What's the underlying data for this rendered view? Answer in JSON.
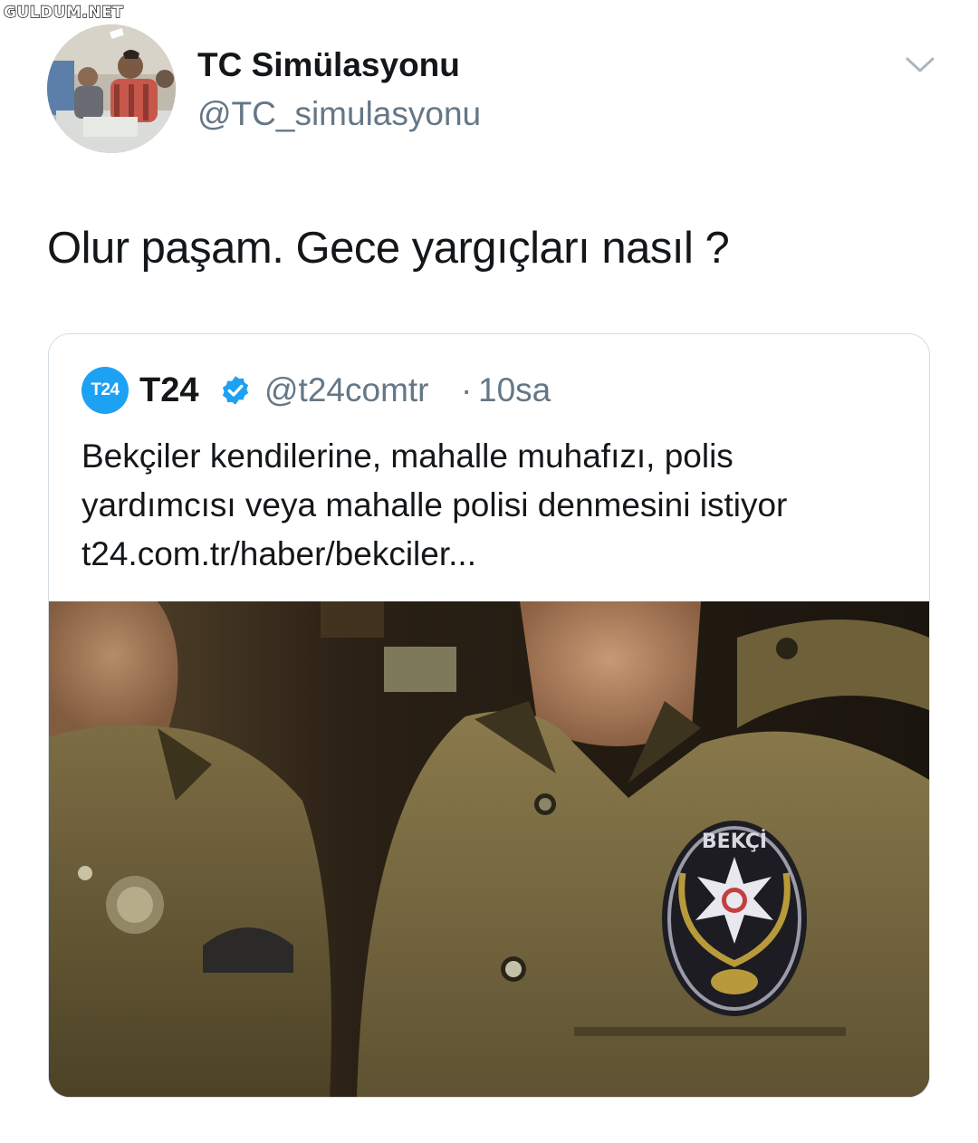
{
  "watermark": "GULDUM.NET",
  "tweet": {
    "display_name": "TC Simülasyonu",
    "handle": "@TC_simulasyonu",
    "text": "Olur paşam. Gece yargıçları nasıl ?",
    "menu_icon": "chevron-down-icon"
  },
  "quoted": {
    "logo_text": "T24",
    "name": "T24",
    "verified_icon": "verified-badge-icon",
    "handle": "@t24comtr",
    "separator": "·",
    "time": "10sa",
    "text_lines": [
      "Bekçiler kendilerine, mahalle muhafızı, polis",
      "yardımcısı veya mahalle polisi denmesini istiyor",
      "t24.com.tr/haber/bekciler..."
    ],
    "image": {
      "patch_text": "BEKÇİ"
    }
  },
  "colors": {
    "text_primary": "#14171a",
    "text_secondary": "#657786",
    "brand_blue": "#1da1f2",
    "card_border": "#d4dde4"
  }
}
